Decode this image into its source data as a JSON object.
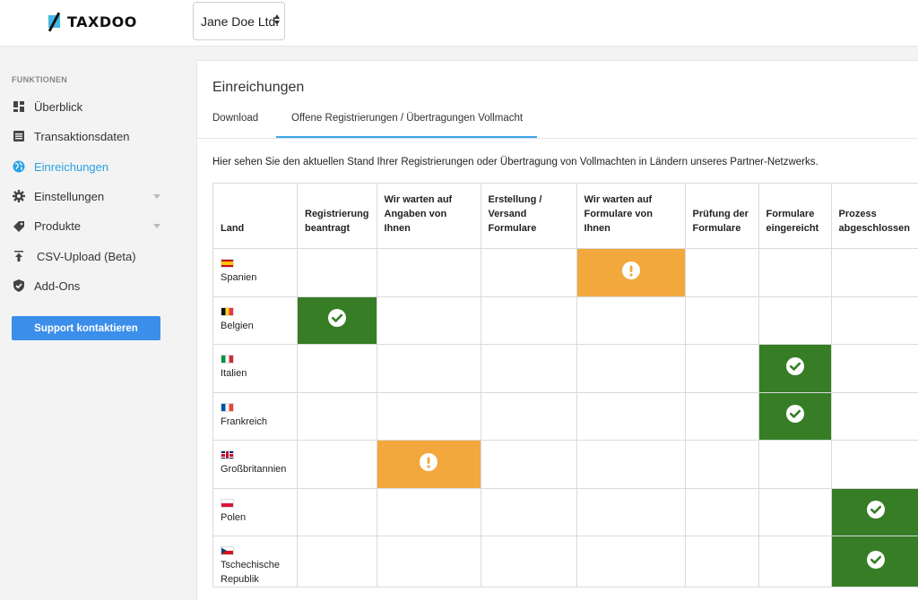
{
  "header": {
    "brand": "TAXDOO",
    "company_select": "Jane Doe Ltd."
  },
  "sidebar": {
    "section_label": "FUNKTIONEN",
    "items": [
      {
        "label": "Überblick",
        "icon": "dashboard-icon"
      },
      {
        "label": "Transaktionsdaten",
        "icon": "list-icon"
      },
      {
        "label": "Einreichungen",
        "icon": "globe-icon",
        "active": true
      },
      {
        "label": "Einstellungen",
        "icon": "gear-icon",
        "has_submenu": true
      },
      {
        "label": "Produkte",
        "icon": "tag-icon",
        "has_submenu": true
      },
      {
        "label": "CSV-Upload (Beta)",
        "icon": "upload-icon"
      },
      {
        "label": "Add-Ons",
        "icon": "shield-icon"
      }
    ],
    "support_button": "Support kontaktieren"
  },
  "main": {
    "title": "Einreichungen",
    "tabs": [
      {
        "label": "Download"
      },
      {
        "label": "Offene Registrierungen / Übertragungen Vollmacht",
        "active": true
      }
    ],
    "intro": "Hier sehen Sie den aktuellen Stand Ihrer Registrierungen oder Übertragung von Vollmachten in Ländern unseres Partner-Netzwerks.",
    "table": {
      "headers": [
        "Land",
        "Registrierung beantragt",
        "Wir warten auf Angaben von Ihnen",
        "Erstellung / Versand Formulare",
        "Wir warten auf Formulare von Ihnen",
        "Prüfung der Formulare",
        "Formulare eingereicht",
        "Prozess abgeschlossen"
      ],
      "rows": [
        {
          "country": "Spanien",
          "flag": "es",
          "stage": 4,
          "status": "warning"
        },
        {
          "country": "Belgien",
          "flag": "be",
          "stage": 1,
          "status": "done"
        },
        {
          "country": "Italien",
          "flag": "it",
          "stage": 6,
          "status": "done"
        },
        {
          "country": "Frankreich",
          "flag": "fr",
          "stage": 6,
          "status": "done"
        },
        {
          "country": "Großbritannien",
          "flag": "gb",
          "stage": 2,
          "status": "warning"
        },
        {
          "country": "Polen",
          "flag": "pl",
          "stage": 7,
          "status": "done"
        },
        {
          "country": "Tschechische Republik",
          "flag": "cz",
          "stage": 7,
          "status": "done"
        }
      ]
    },
    "colors": {
      "done": "#367d25",
      "warning": "#f2a83c",
      "accent": "#29a3e3",
      "button": "#3b8eea"
    }
  }
}
